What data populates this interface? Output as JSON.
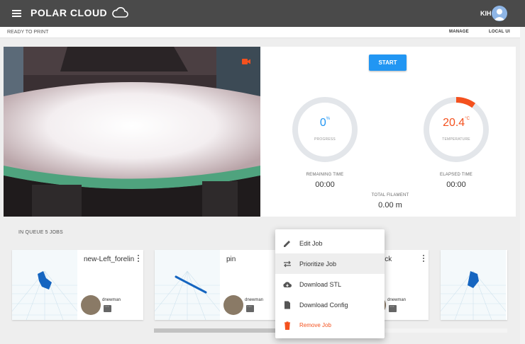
{
  "header": {
    "brand": "POLAR CLOUD",
    "user_initials": "KIH"
  },
  "status": {
    "text": "READY TO PRINT",
    "manage_label": "MANAGE",
    "local_ui_label": "LOCAL UI"
  },
  "controls": {
    "start_label": "START"
  },
  "progress": {
    "value": "0",
    "unit": "%",
    "label": "PROGRESS",
    "fraction": 0
  },
  "temperature": {
    "value": "20.4",
    "unit": "°C",
    "label": "TEMPERATURE",
    "arc_fraction": 0.1,
    "color": "#f4511e"
  },
  "stats": {
    "remaining_label": "REMAINING TIME",
    "remaining_value": "00:00",
    "elapsed_label": "ELAPSED TIME",
    "elapsed_value": "00:00",
    "filament_label": "TOTAL FILAMENT",
    "filament_value": "0.00 m"
  },
  "queue": {
    "title": "IN QUEUE 5 JOBS",
    "jobs": [
      {
        "name": "new-Left_forelin",
        "user": "dnewman"
      },
      {
        "name": "pin",
        "user": "dnewman"
      },
      {
        "name": "e-block",
        "user": "dnewman"
      }
    ]
  },
  "context_menu": {
    "items": [
      {
        "label": "Edit Job",
        "icon": "pencil-icon"
      },
      {
        "label": "Prioritize Job",
        "icon": "swap-arrows-icon"
      },
      {
        "label": "Download STL",
        "icon": "cloud-download-icon"
      },
      {
        "label": "Download Config",
        "icon": "document-icon"
      },
      {
        "label": "Remove Job",
        "icon": "trash-icon"
      }
    ]
  },
  "colors": {
    "accent": "#2196f3",
    "danger": "#f4511e",
    "topbar": "#4a4a4a"
  }
}
